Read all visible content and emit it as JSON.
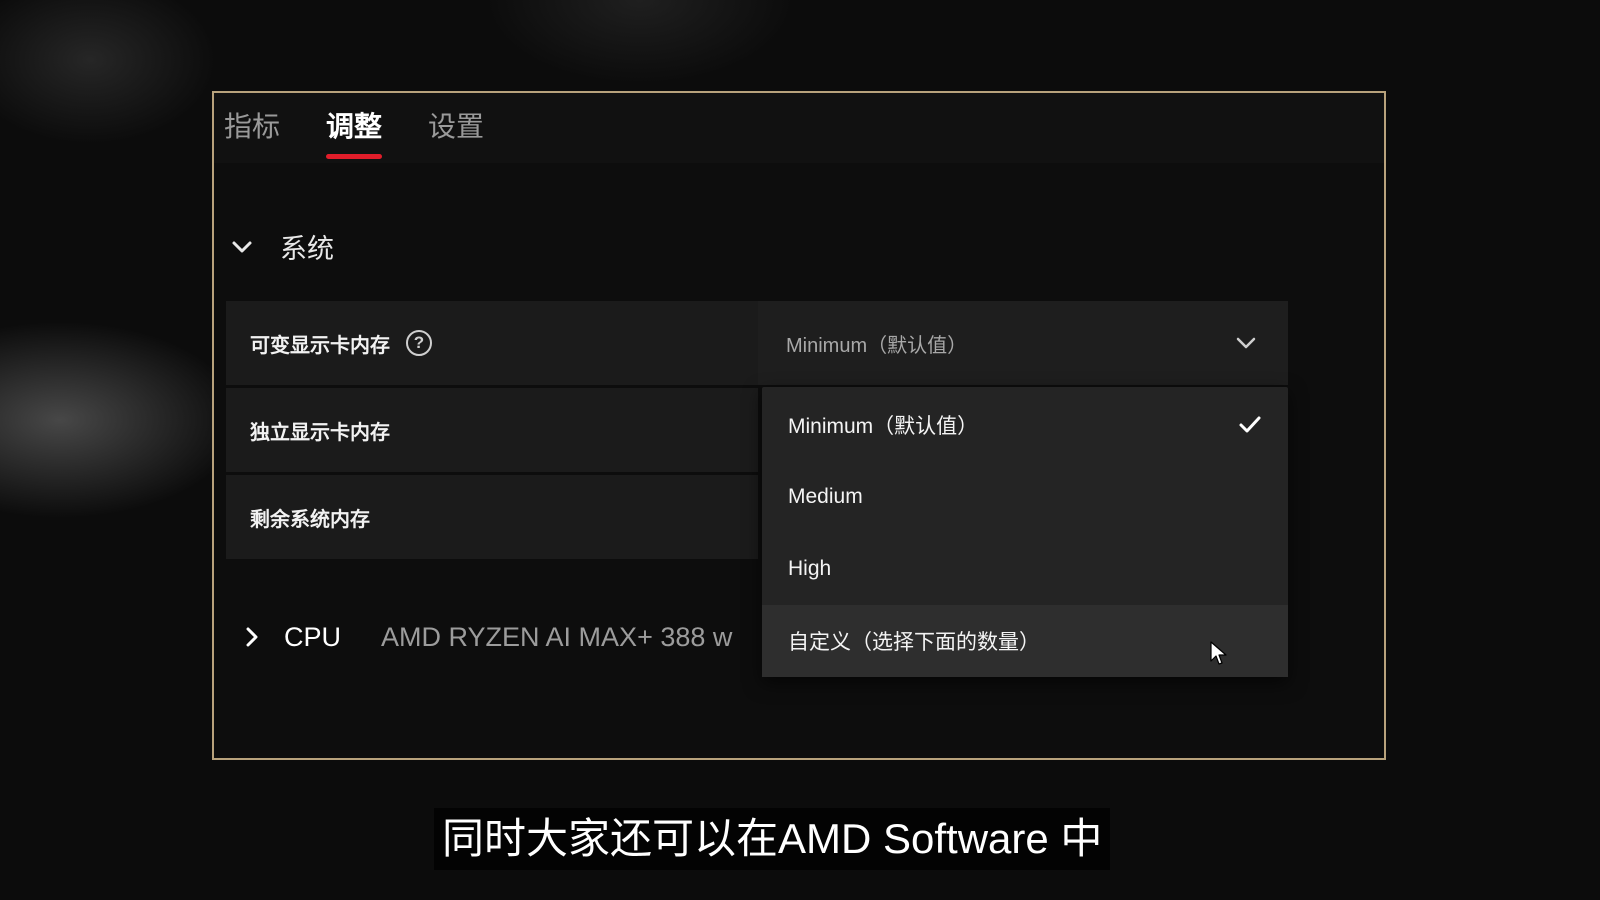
{
  "tabs": [
    {
      "label": "指标",
      "active": false
    },
    {
      "label": "调整",
      "active": true
    },
    {
      "label": "设置",
      "active": false
    }
  ],
  "system_section": {
    "label": "系统",
    "expanded": true,
    "rows": [
      {
        "label": "可变显示卡内存",
        "has_help": true
      },
      {
        "label": "独立显示卡内存"
      },
      {
        "label": "剩余系统内存"
      }
    ],
    "select_value": "Minimum（默认值）"
  },
  "dropdown": {
    "options": [
      {
        "label": "Minimum（默认值）",
        "selected": true
      },
      {
        "label": "Medium"
      },
      {
        "label": "High"
      },
      {
        "label": "自定义（选择下面的数量）",
        "hovered": true
      }
    ]
  },
  "cpu_section": {
    "label": "CPU",
    "value": "AMD RYZEN AI MAX+ 388 w",
    "expanded": false
  },
  "help_icon_glyph": "?",
  "subtitle": "同时大家还可以在AMD Software 中",
  "colors": {
    "accent": "#e11d2a",
    "frame_border": "#b8a27c",
    "panel_bg": "#1b1b1b",
    "dropdown_bg": "#242424"
  }
}
